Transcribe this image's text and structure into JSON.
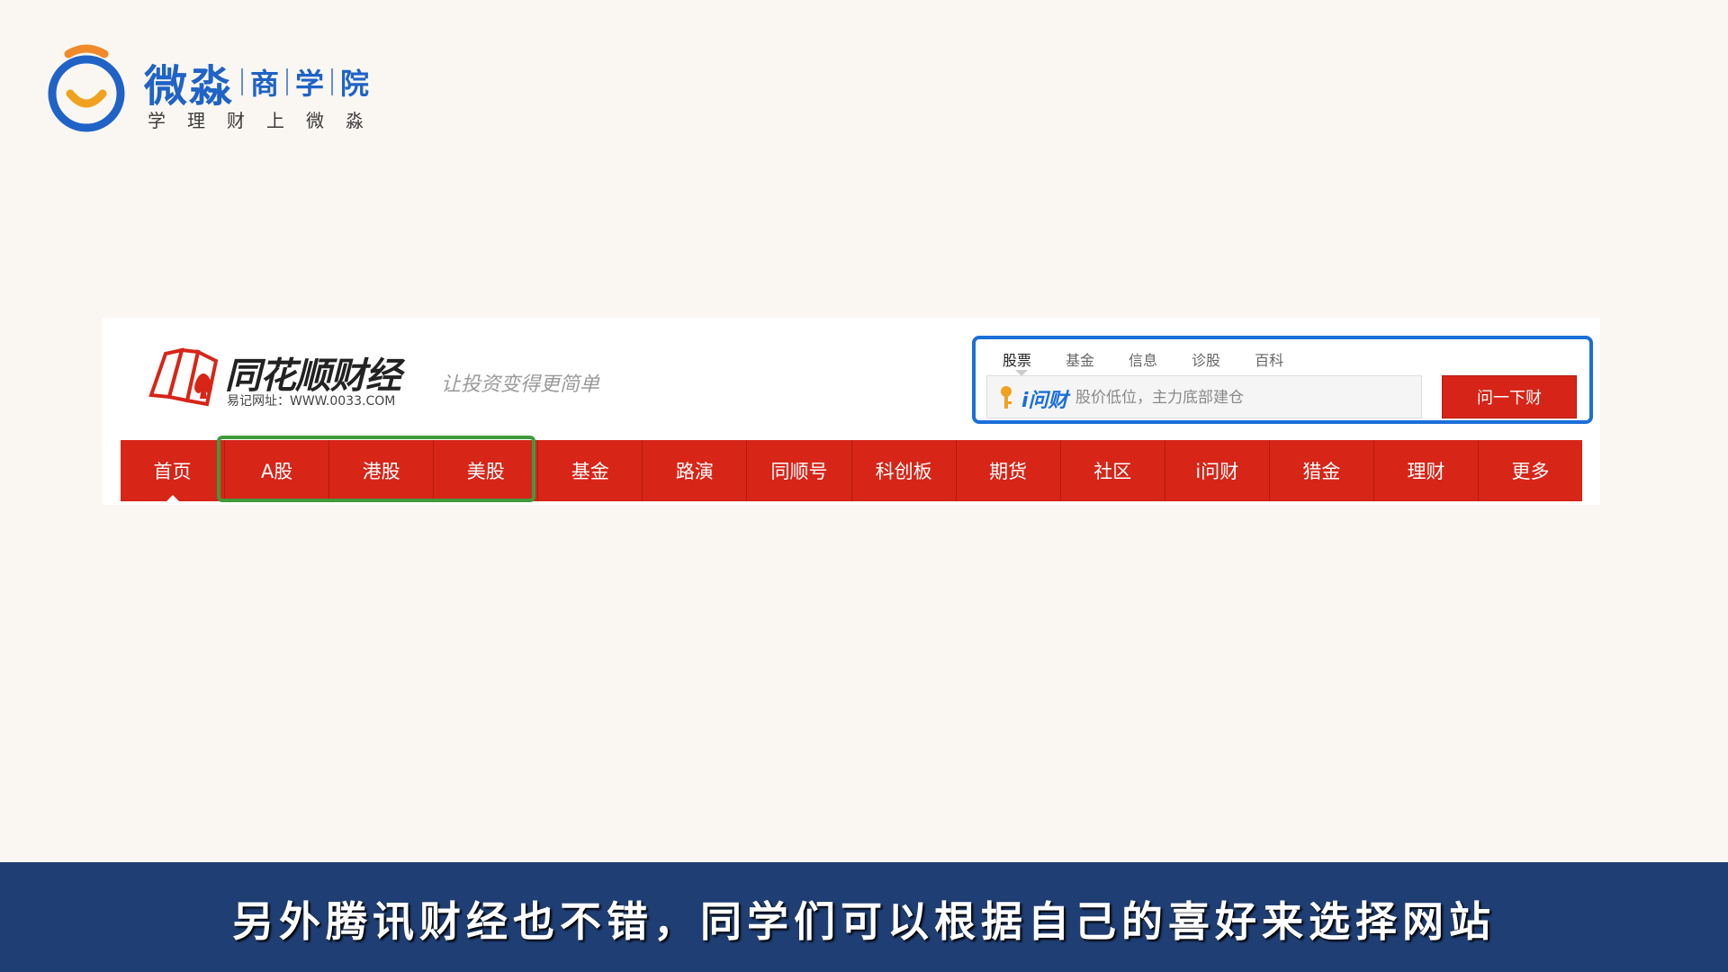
{
  "brand": {
    "name": "微淼",
    "sub1": "商",
    "sub2": "学",
    "sub3": "院",
    "slogan": "学理财上微淼",
    "colors": {
      "blue": "#1f63c6",
      "orange": "#f08a2a"
    }
  },
  "site": {
    "name": "同花顺财经",
    "url": "易记网址：WWW.0033.COM",
    "tagline": "让投资变得更简单",
    "search": {
      "tabs": [
        "股票",
        "基金",
        "信息",
        "诊股",
        "百科"
      ],
      "active_tab": "股票",
      "brand": "i问财",
      "placeholder": "股价低位，主力底部建仓",
      "button": "问一下财"
    },
    "nav": [
      "首页",
      "A股",
      "港股",
      "美股",
      "基金",
      "路演",
      "同顺号",
      "科创板",
      "期货",
      "社区",
      "i问财",
      "猎金",
      "理财",
      "更多"
    ],
    "colors": {
      "nav_red": "#d72518",
      "highlight_green": "#3f9a3c",
      "search_border": "#1a6fd8"
    }
  },
  "subtitle": "另外腾讯财经也不错，同学们可以根据自己的喜好来选择网站"
}
